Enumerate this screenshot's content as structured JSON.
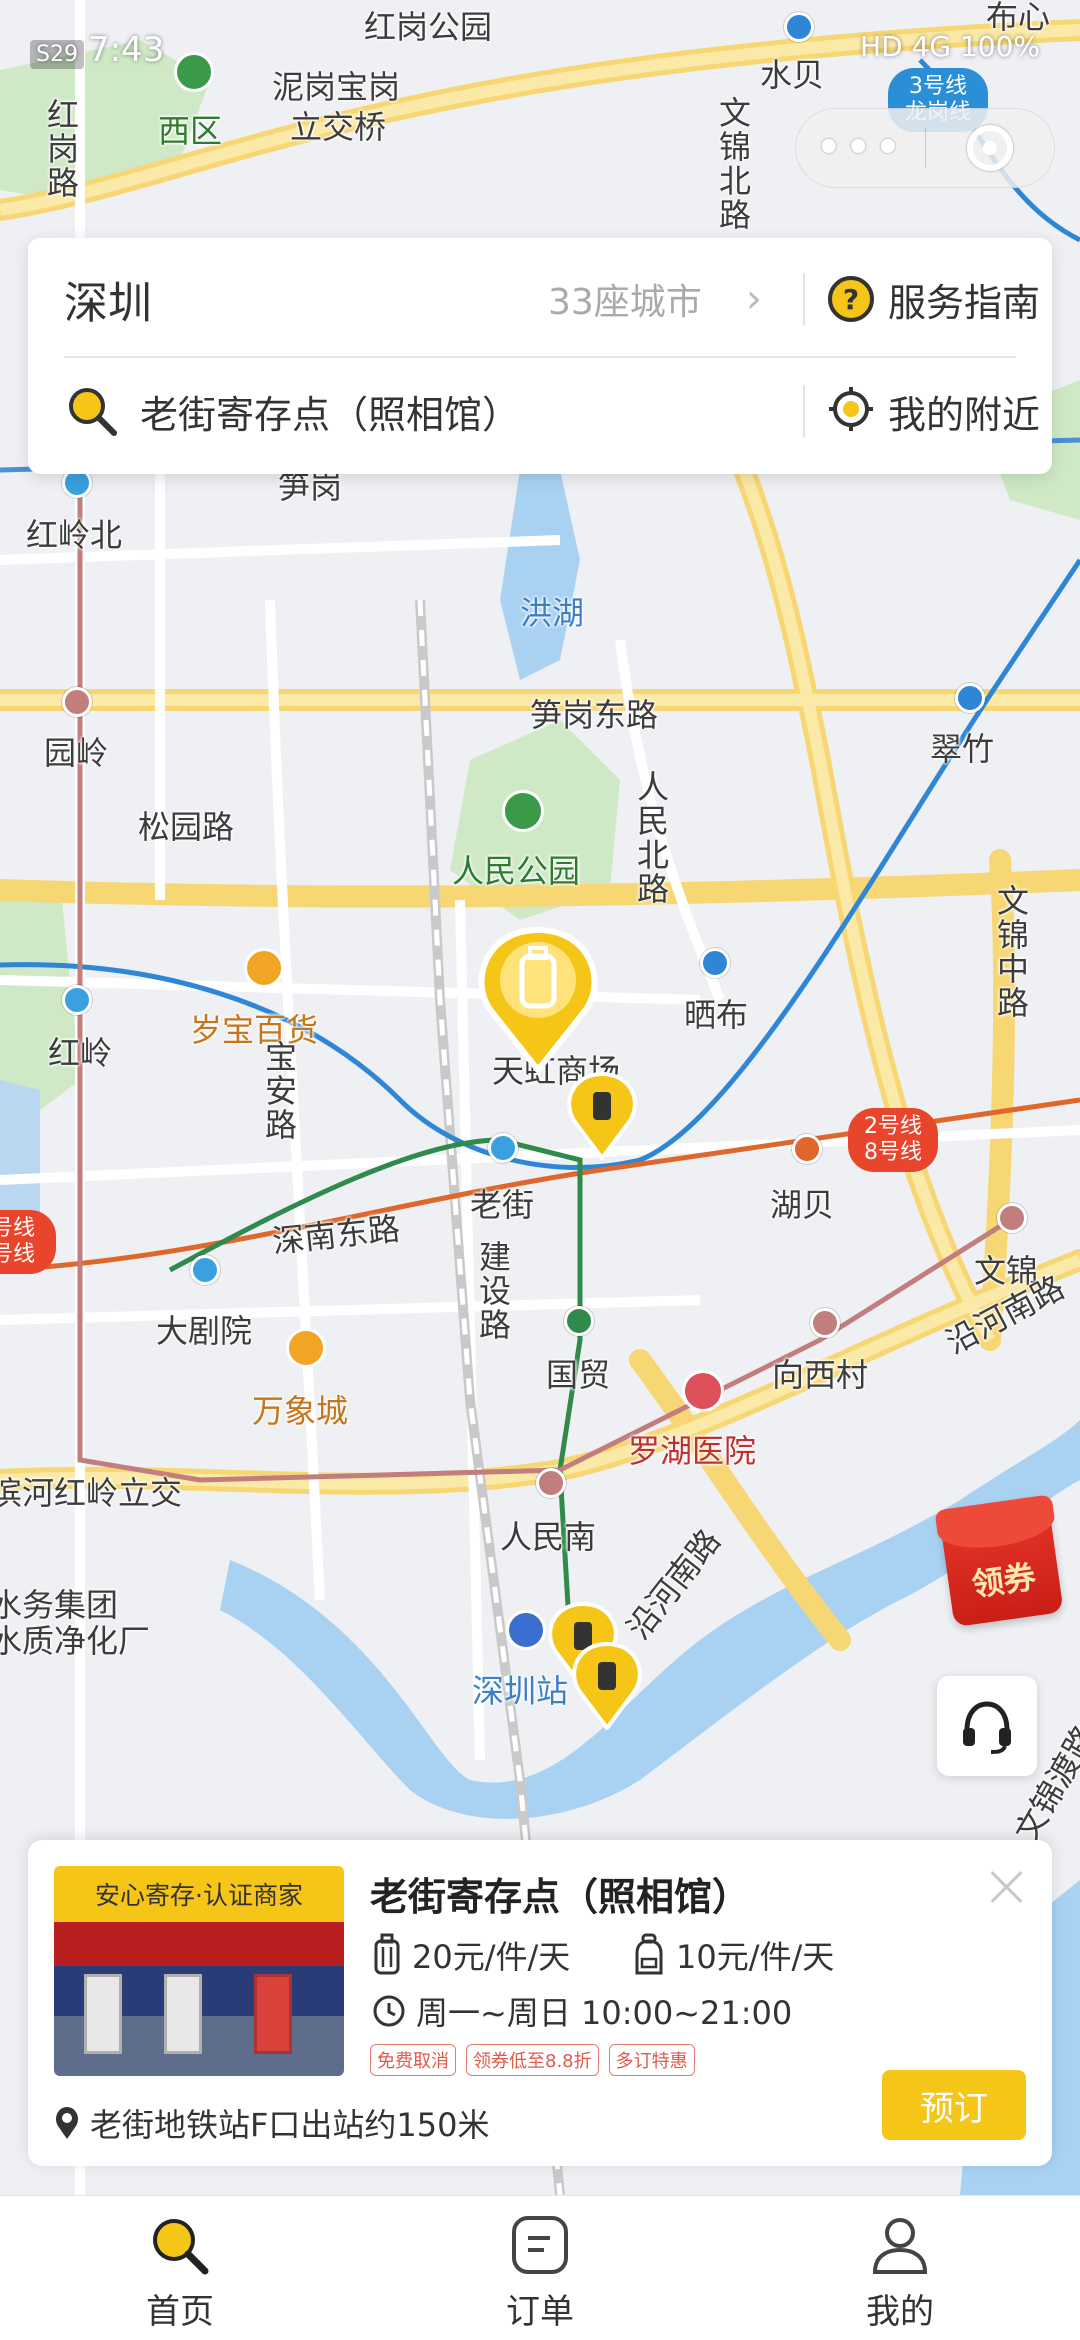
{
  "status_bar": {
    "time": "7:43",
    "carrier_badge": "S29",
    "right": "HD 4G 100%"
  },
  "capsule": {
    "more_label": "•••"
  },
  "map": {
    "labels": [
      {
        "text": "红岗公园"
      },
      {
        "text": "泥岗宝岗"
      },
      {
        "text": "立交桥"
      },
      {
        "text": "西区"
      },
      {
        "text": "红岗路"
      },
      {
        "text": "水贝"
      },
      {
        "text": "文锦北路"
      },
      {
        "text": "红岭北"
      },
      {
        "text": "笋岗"
      },
      {
        "text": "洪湖"
      },
      {
        "text": "笋岗东路"
      },
      {
        "text": "园岭"
      },
      {
        "text": "松园路"
      },
      {
        "text": "人民公园"
      },
      {
        "text": "人民北路"
      },
      {
        "text": "翠竹"
      },
      {
        "text": "文锦中路"
      },
      {
        "text": "红岭"
      },
      {
        "text": "岁宝百货"
      },
      {
        "text": "宝安路"
      },
      {
        "text": "晒布"
      },
      {
        "text": "天虹商场"
      },
      {
        "text": "老街"
      },
      {
        "text": "深南东路"
      },
      {
        "text": "湖贝"
      },
      {
        "text": "文锦"
      },
      {
        "text": "大剧院"
      },
      {
        "text": "建设路"
      },
      {
        "text": "国贸"
      },
      {
        "text": "向西村"
      },
      {
        "text": "万象城"
      },
      {
        "text": "罗湖医院"
      },
      {
        "text": "沿河南路"
      },
      {
        "text": "滨河红岭立交"
      },
      {
        "text": "人民南"
      },
      {
        "text": "水务集团"
      },
      {
        "text": "水质净化厂"
      },
      {
        "text": "深圳站"
      },
      {
        "text": "布心"
      },
      {
        "text": "文锦渡路"
      }
    ],
    "line_badges": [
      {
        "text": "3号线 龙岗线",
        "color": "#2a8fd6"
      },
      {
        "text": "2号线 8号线",
        "color": "#e8452c"
      },
      {
        "text": "号线 号线",
        "color": "#e8452c"
      }
    ]
  },
  "search_card": {
    "city": "深圳",
    "city_count": "33座城市",
    "guide_label": "服务指南",
    "search_text": "老街寄存点（照相馆）",
    "nearby_label": "我的附近"
  },
  "floating": {
    "coupon_label": "领券"
  },
  "store": {
    "badge": "安心寄存·认证商家",
    "title": "老街寄存点（照相馆）",
    "price_large": "20元/件/天",
    "price_small": "10元/件/天",
    "hours": "周一~周日 10:00~21:00",
    "tags": [
      "免费取消",
      "领券低至8.8折",
      "多订特惠"
    ],
    "address": "老街地铁站F口出站约150米",
    "book_label": "预订",
    "accent": "#f5c518"
  },
  "tabs": [
    {
      "label": "首页",
      "icon": "search-icon"
    },
    {
      "label": "订单",
      "icon": "order-icon"
    },
    {
      "label": "我的",
      "icon": "profile-icon"
    }
  ]
}
